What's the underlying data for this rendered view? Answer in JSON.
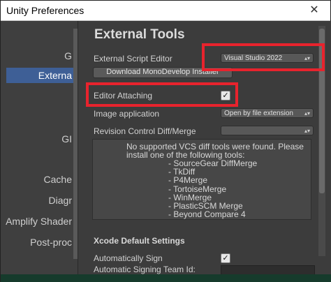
{
  "window": {
    "title": "Unity Preferences",
    "close_icon": "close-icon"
  },
  "sidebar": {
    "items": [
      {
        "label": "G"
      },
      {
        "label": "Externa"
      },
      {
        "label": "GI"
      },
      {
        "label": "Cache"
      },
      {
        "label": "Diagr"
      },
      {
        "label": "Amplify Shader"
      },
      {
        "label": "Post-proc"
      }
    ],
    "selected_index": 1
  },
  "section": {
    "title": "External Tools"
  },
  "fields": {
    "script_editor_label": "External Script Editor",
    "script_editor_value": "Visual Studio 2022",
    "download_button": "Download MonoDevelop Installer",
    "editor_attaching_label": "Editor Attaching",
    "editor_attaching_checked": true,
    "image_application_label": "Image application",
    "image_application_value": "Open by file extension",
    "revision_control_label": "Revision Control Diff/Merge",
    "revision_control_value": ""
  },
  "vcs_message": {
    "line1": "No supported VCS diff tools were found. Please",
    "line2": "install one of the following tools:",
    "tools": [
      "- SourceGear DiffMerge",
      "- TkDiff",
      "- P4Merge",
      "- TortoiseMerge",
      "- WinMerge",
      "- PlasticSCM Merge",
      "- Beyond Compare 4"
    ]
  },
  "xcode": {
    "title": "Xcode Default Settings",
    "automatically_sign_label": "Automatically Sign",
    "automatically_sign_checked": true,
    "team_id_label": "Automatic Signing Team Id:",
    "team_id_value": ""
  },
  "colors": {
    "highlight": "#e8232d",
    "selection": "#3e5f96",
    "panel": "#3c3c3c"
  }
}
